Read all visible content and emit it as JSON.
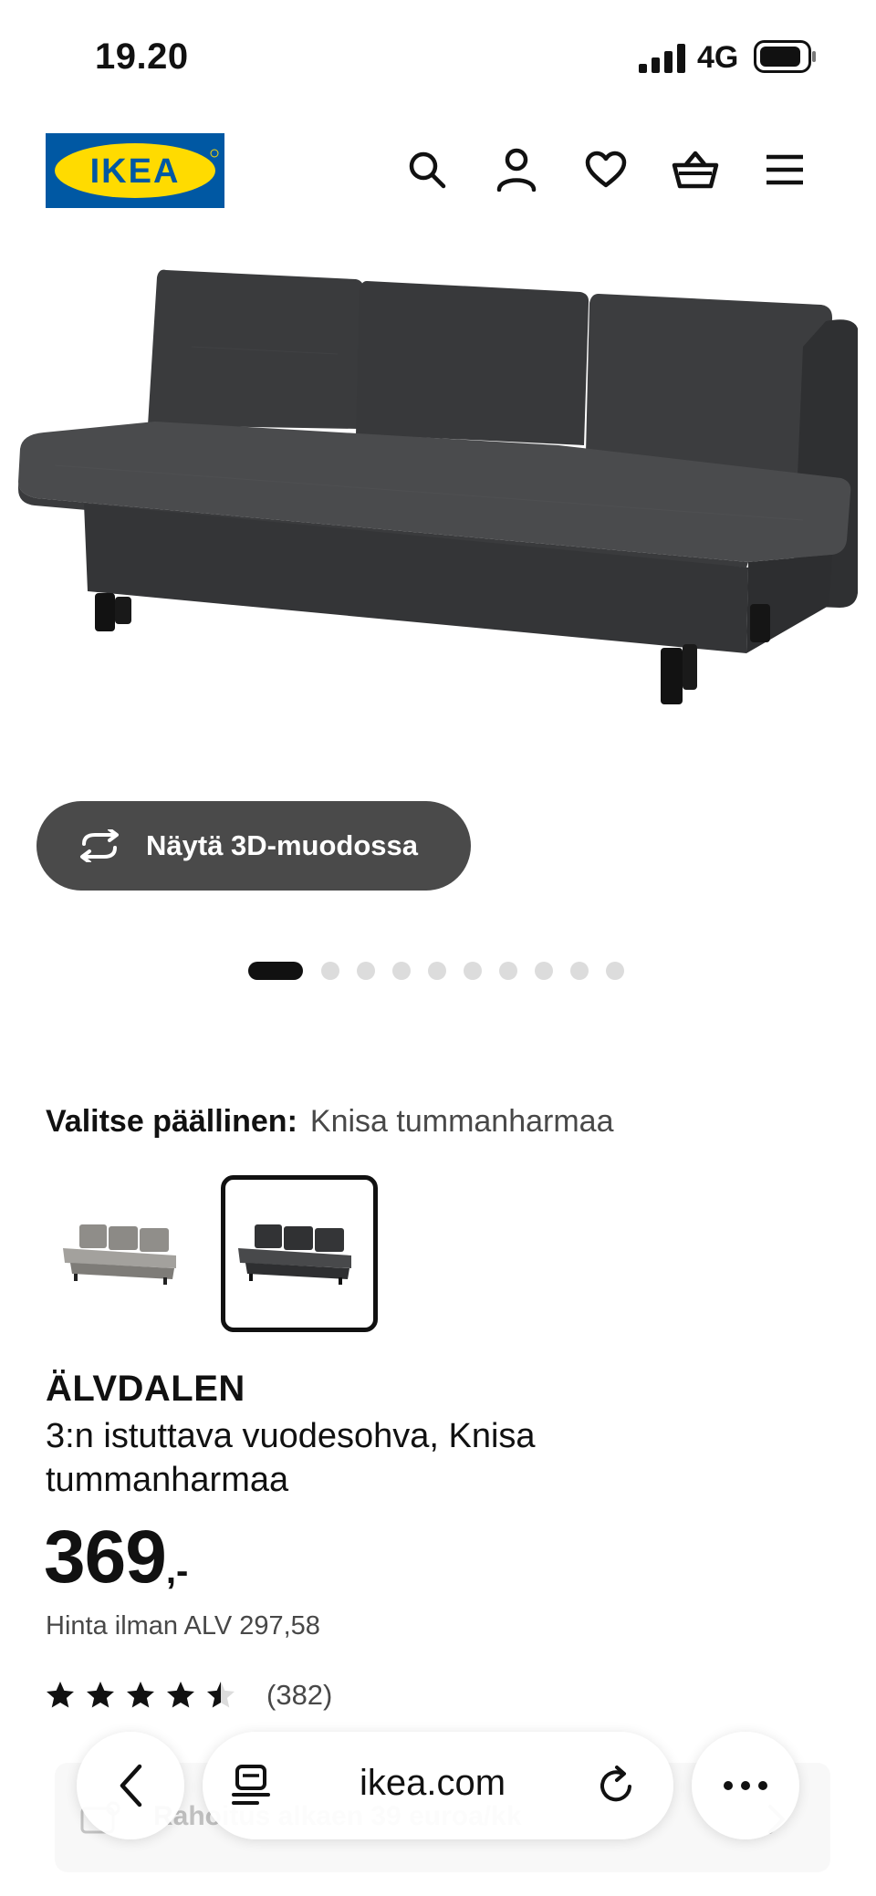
{
  "status_bar": {
    "time": "19.20",
    "network": "4G",
    "icons": [
      "signal-icon",
      "battery-icon"
    ]
  },
  "header": {
    "logo_text": "IKEA",
    "icons": [
      "search-icon",
      "account-icon",
      "heart-icon",
      "cart-icon",
      "menu-icon"
    ],
    "colors": {
      "logo_blue": "#0058A3",
      "logo_yellow": "#FFDB00"
    }
  },
  "gallery": {
    "view_3d_label": "Näytä 3D-muodossa",
    "dot_count": 10,
    "active_index": 0
  },
  "variant": {
    "label": "Valitse päällinen:",
    "selected_value": "Knisa tummanharmaa",
    "swatches": [
      {
        "name": "light-grey-sofa",
        "selected": false
      },
      {
        "name": "dark-grey-sofa",
        "selected": true
      }
    ]
  },
  "product": {
    "name": "ÄLVDALEN",
    "description": "3:n istuttava vuodesohva, Knisa tummanharmaa",
    "price_integer": "369",
    "price_suffix": ",-",
    "price_without_vat": "Hinta ilman ALV 297,58",
    "rating_value": 4.5,
    "rating_count": "(382)"
  },
  "financing": {
    "text": "Rahoitus alkaen 39 euroa/kk"
  },
  "browser": {
    "domain": "ikea.com",
    "icons": [
      "back-icon",
      "reader-icon",
      "reload-icon",
      "more-icon"
    ]
  }
}
